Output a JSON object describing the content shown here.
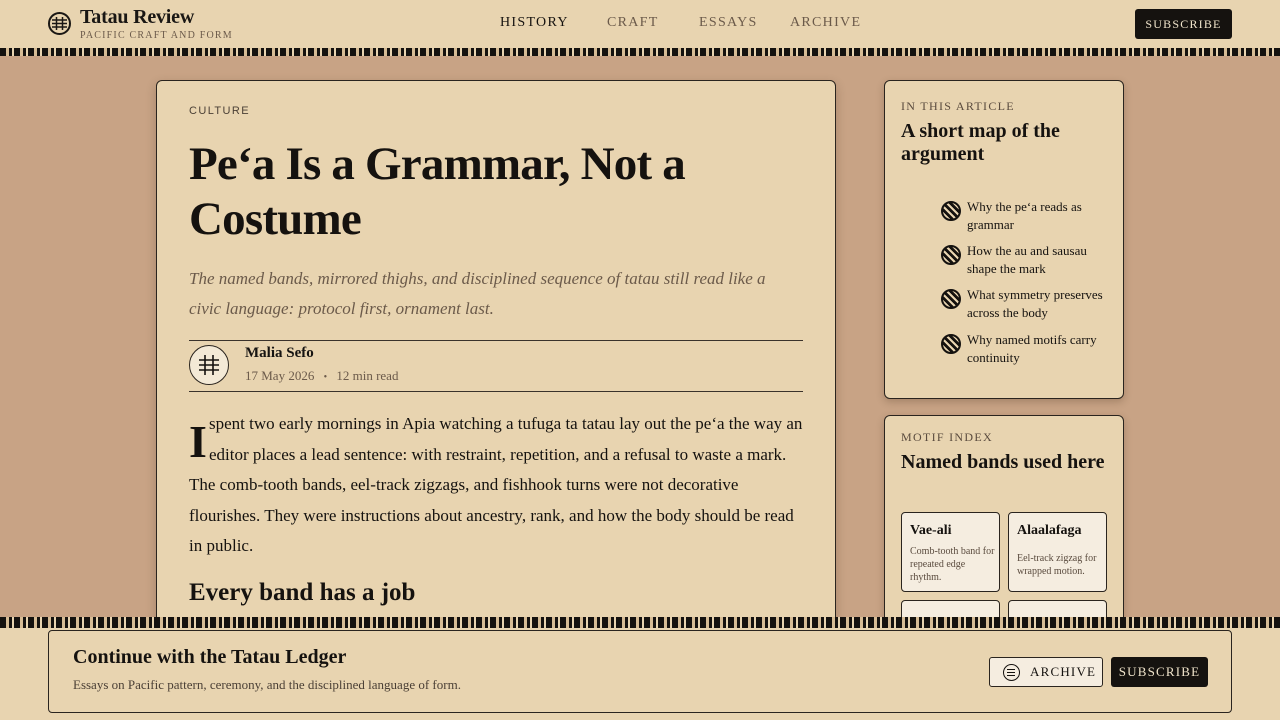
{
  "brand": {
    "title": "Tatau Review",
    "subtitle": "PACIFIC CRAFT AND FORM"
  },
  "nav": {
    "items": [
      {
        "label": "HISTORY",
        "active": true
      },
      {
        "label": "CRAFT",
        "active": false
      },
      {
        "label": "ESSAYS",
        "active": false
      },
      {
        "label": "ARCHIVE",
        "active": false
      }
    ]
  },
  "header": {
    "subscribe_label": "SUBSCRIBE"
  },
  "article": {
    "kicker": "CULTURE",
    "headline": "Pe‘a Is a Grammar, Not a Costume",
    "dek": "The named bands, mirrored thighs, and disciplined sequence of tatau still read like a civic language: protocol first, ornament last.",
    "author": "Malia Sefo",
    "date": "17 May 2026",
    "read_time": "12 min read",
    "meta_separator": "•",
    "dropcap": "I",
    "body_line1": "spent two early mornings in Apia watching a tufuga ta tatau lay out the pe‘a the way an",
    "body_line2": "editor places a lead sentence: with restraint, repetition, and a refusal to waste a mark.",
    "body_rest": "The comb-tooth bands, eel-track zigzags, and fishhook turns were not decorative flourishes. They were instructions about ancestry, rank, and how the body should be read in public.",
    "section_heading": "Every band has a job"
  },
  "toc": {
    "kicker": "IN THIS ARTICLE",
    "title": "A short map of the argument",
    "items": [
      {
        "label": "Why the pe‘a reads as grammar",
        "icon": "striped-circle-icon"
      },
      {
        "label": "How the au and sausau shape the mark",
        "icon": "striped-circle-icon"
      },
      {
        "label": "What symmetry preserves across the body",
        "icon": "striped-circle-icon"
      },
      {
        "label": "Why named motifs carry continuity",
        "icon": "striped-circle-icon"
      }
    ]
  },
  "motifs": {
    "kicker": "MOTIF INDEX",
    "title": "Named bands used here",
    "items": [
      {
        "name": "Vae-ali",
        "desc": "Comb-tooth band for repeated edge rhythm."
      },
      {
        "name": "Alaalafaga",
        "desc": "Eel-track zigzag for wrapped motion."
      }
    ]
  },
  "cta": {
    "title": "Continue with the Tatau Ledger",
    "subtitle": "Essays on Pacific pattern, ceremony, and the disciplined language of form.",
    "archive_label": "ARCHIVE",
    "subscribe_label": "SUBSCRIBE"
  },
  "colors": {
    "background": "#c8a385",
    "paper": "#e8d4b0",
    "ink": "#15120f",
    "muted": "#6b5a4a"
  }
}
